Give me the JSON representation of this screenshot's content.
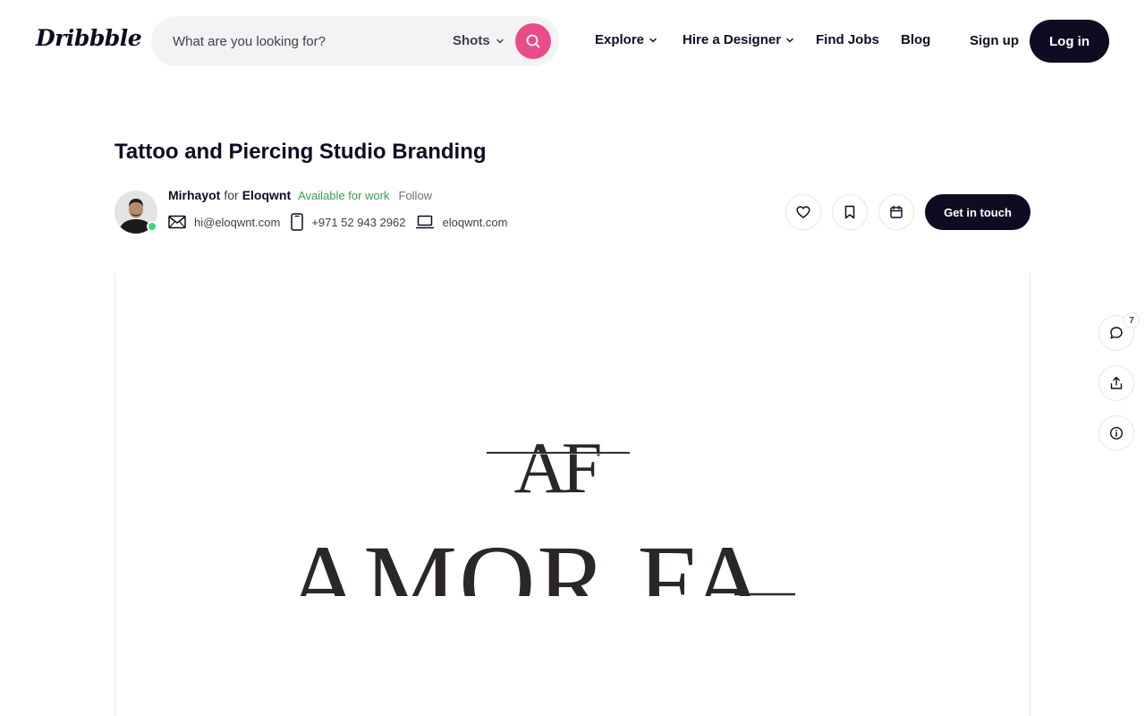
{
  "header": {
    "logo": "Dribbble",
    "search": {
      "placeholder": "What are you looking for?",
      "type": "Shots"
    },
    "nav": {
      "explore": "Explore",
      "hire": "Hire a Designer",
      "jobs": "Find Jobs",
      "blog": "Blog"
    },
    "signup": "Sign up",
    "login": "Log in"
  },
  "shot": {
    "title": "Tattoo and Piercing Studio Branding",
    "author": "Mirhayot",
    "for_word": "for",
    "team": "Eloqwnt",
    "availability": "Available for work",
    "follow": "Follow",
    "contacts": {
      "email": "hi@eloqwnt.com",
      "phone": "+971 52 943 2962",
      "website": "eloqwnt.com"
    },
    "cta": "Get in touch",
    "artwork": {
      "monogram": "AF",
      "wordmark_partial": "AMOR FA"
    }
  },
  "side": {
    "comment_count": "7"
  },
  "colors": {
    "accent": "#ea4c89",
    "dark": "#0d0c22",
    "available": "#3a9d4f",
    "online": "#3dd67c"
  }
}
